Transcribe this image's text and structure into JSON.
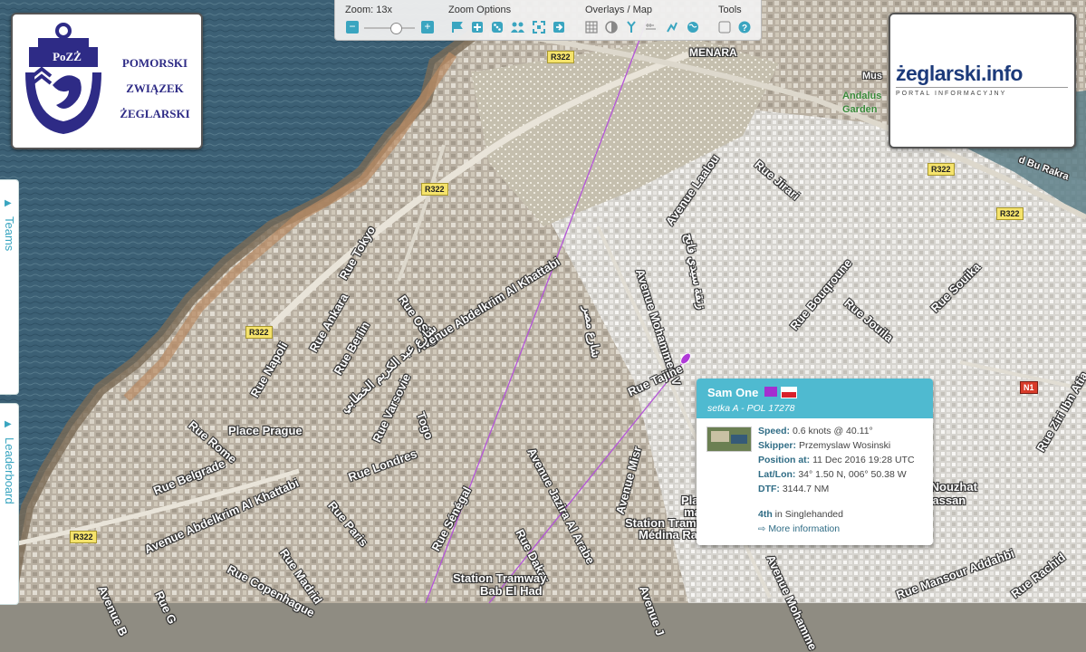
{
  "toolbar": {
    "zoom_label": "Zoom: 13x",
    "zoom_value": 0.62,
    "zoom_options_label": "Zoom Options",
    "overlays_label": "Overlays / Map",
    "tools_label": "Tools"
  },
  "logo_left": {
    "text_logo": "PoZŻ",
    "line1": "POMORSKI",
    "line2": "ZWIĄZEK",
    "line3": "ŻEGLARSKI"
  },
  "logo_right": {
    "title": "żeglarski.info",
    "subtitle": "PORTAL INFORMACYJNY"
  },
  "side_tabs": {
    "teams": "Teams",
    "leaderboard": "Leaderboard"
  },
  "popup": {
    "boat_name": "Sam One",
    "subtitle": "setka A - POL 17278",
    "speed_label": "Speed:",
    "speed_value": "0.6 knots @ 40.11°",
    "skipper_label": "Skipper:",
    "skipper_value": "Przemyslaw Wosinski",
    "position_label": "Position at:",
    "position_value": "11 Dec 2016 19:28 UTC",
    "latlon_label": "Lat/Lon:",
    "latlon_value": "34° 1.50 N, 006° 50.38 W",
    "dtf_label": "DTF:",
    "dtf_value": "3144.7 NM",
    "rank_strong": "4th",
    "rank_rest": "in Singlehanded",
    "more_info": "More information",
    "flag_color": "#a32fd0"
  },
  "map": {
    "roads": [
      "R322",
      "R322",
      "R322",
      "R322",
      "R322",
      "R322",
      "N1"
    ],
    "labels": {
      "menara": "MENARA",
      "andalus": "Andalus",
      "garden": "Garden",
      "museum": "Mus",
      "bu_rakra": "d Bu Rakra",
      "rue_tokyo": "Rue Tokyo",
      "rue_oslo": "Rue OSLO",
      "rue_ankara": "Rue Ankara",
      "rue_berlin": "Rue Berlin",
      "rue_napoli": "Rue Napoli",
      "av_abdelkrim": "Avenue Abdelkrim Al Khattabi",
      "av_abdelkrim2": "Avenue Abdelkrim Al Khattabi",
      "arabic1": "شارع عبد الكريم الخطابي",
      "arabic_misr": "شارع مصر",
      "arabic_mhamed": "زنقة سيدي فاتح",
      "rue_varsovie": "Rue Varsovie",
      "togo": "Togo",
      "place_prague": "Place Prague",
      "rue_rome": "Rue Rome",
      "rue_londres": "Rue Londres",
      "rue_belgrade": "Rue Belgrade",
      "rue_paris": "Rue Paris",
      "rue_copenhague": "Rue Copenhague",
      "rue_madrid": "Rue Madrid",
      "rue_senegal": "Rue Sénégal",
      "rue_dakar": "Rue Dakar",
      "av_jazira": "Avenue Jazira Al Arabe",
      "av_misr": "Avenue Misr",
      "av_mohammed": "Avenue Mohammed V",
      "av_laalou": "Avenue Laalou",
      "rue_jirari": "Rue Jirari",
      "rue_bouqroune": "Rue Bouqroune",
      "rue_jouila": "Rue Jouila",
      "rue_souika": "Rue Souika",
      "rue_tajine": "Rue Tajine",
      "station1": "Station Tramway",
      "station1b": "Médina Rab",
      "station2": "Station Tramway",
      "station2b": "Bab El Had",
      "place_marche": "Place du",
      "place_marche2": "marché",
      "jardin": "Jardin Nouzhat",
      "hassan": "Hassan",
      "rue_mansour": "Rue Mansour Addahbi",
      "rue_ziri": "Rue Ziri Ibn Atia",
      "rue_rachid": "Rue Rachid",
      "av_b": "Avenue B",
      "rue_g": "Rue G",
      "rue_j": "Avenue J",
      "av_mohammed2": "Avenue Mohamme"
    }
  }
}
